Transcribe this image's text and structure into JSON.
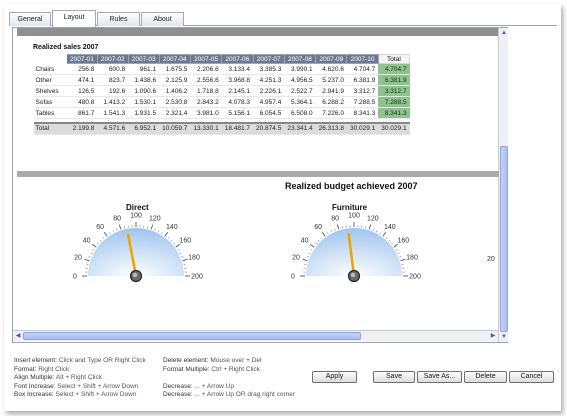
{
  "tabs": [
    {
      "label": "General"
    },
    {
      "label": "Layout"
    },
    {
      "label": "Rules"
    },
    {
      "label": "About"
    }
  ],
  "table": {
    "title": "Realized sales 2007",
    "columns": [
      "2007-01",
      "2007-02",
      "2007-03",
      "2007-04",
      "2007-05",
      "2007-06",
      "2007-07",
      "2007-08",
      "2007-09",
      "2007-10"
    ],
    "total_label": "Total",
    "rows": [
      {
        "label": "Chairs",
        "values": [
          "256.8",
          "600.8",
          "961.1",
          "1.675.5",
          "2.206.6",
          "3.133.4",
          "3.385.3",
          "3.990.1",
          "4.620.6",
          "4.704.7"
        ],
        "total": "4.704.7"
      },
      {
        "label": "Other",
        "values": [
          "474.1",
          "823.7",
          "1.438.6",
          "2.125.9",
          "2.556.6",
          "3.968.8",
          "4.251.3",
          "4.956.5",
          "5.237.0",
          "6.381.9"
        ],
        "total": "6.381.9"
      },
      {
        "label": "Shelves",
        "values": [
          "126.5",
          "192.6",
          "1.090.6",
          "1.406.2",
          "1.718.8",
          "2.145.1",
          "2.226.1",
          "2.522.7",
          "2.941.9",
          "3.312.7"
        ],
        "total": "3.312.7"
      },
      {
        "label": "Sofas",
        "values": [
          "480.8",
          "1.413.2",
          "1.530.1",
          "2.530.8",
          "2.843.2",
          "4.078.3",
          "4.957.4",
          "5.364.1",
          "6.288.2",
          "7.288.5"
        ],
        "total": "7.288.5"
      },
      {
        "label": "Tables",
        "values": [
          "861.7",
          "1.541.3",
          "1.931.5",
          "2.321.4",
          "3.981.0",
          "5.156.1",
          "6.054.5",
          "6.508.0",
          "7.226.0",
          "8.341.3"
        ],
        "total": "8.341.3"
      }
    ],
    "sum": {
      "label": "Total",
      "values": [
        "2.199.8",
        "4.571.6",
        "6.952.1",
        "10.059.7",
        "13.330.1",
        "18.481.7",
        "20.874.5",
        "23.341.4",
        "26.313.8",
        "30.029.1"
      ],
      "total": "30.029.1"
    }
  },
  "budget_title": "Realized budget achieved 2007",
  "gauges": [
    {
      "title": "Direct",
      "value": 88,
      "ticks": [
        "0",
        "20",
        "40",
        "60",
        "80",
        "100",
        "120",
        "140",
        "160",
        "180",
        "200"
      ]
    },
    {
      "title": "Furniture",
      "value": 92,
      "ticks": [
        "0",
        "20",
        "40",
        "60",
        "80",
        "100",
        "120",
        "140",
        "160",
        "180",
        "200"
      ]
    }
  ],
  "third_gauge_partial_tick": "20",
  "help": {
    "col1": [
      {
        "k": "Insert element: ",
        "v": "Click and Type OR Right Click"
      },
      {
        "k": "Format: ",
        "v": "Right Click"
      },
      {
        "k": "Align Multiple: ",
        "v": "Alt + Right Click"
      },
      {
        "k": "Font Increase: ",
        "v": "Select + Shift + Arrow Down"
      },
      {
        "k": "Box Increase: ",
        "v": "Select + Shift + Arrow Down"
      }
    ],
    "col2": [
      {
        "k": "Delete element: ",
        "v": "Mouse over + Del"
      },
      {
        "k": "Format Multiple: ",
        "v": "Ctrl + Right Click"
      },
      {
        "k": "",
        "v": ""
      },
      {
        "k": "Decrease: ",
        "v": "... + Arrow Up"
      },
      {
        "k": "Decrease: ",
        "v": "... + Arrow Up OR drag right corner"
      }
    ]
  },
  "buttons": {
    "apply": "Apply",
    "save": "Save",
    "save_as": "Save As...",
    "delete": "Delete",
    "cancel": "Cancel"
  },
  "colors": {
    "header_bg": "#6c7a91",
    "total_bg": "#8fc28c",
    "needle": "#e8a800",
    "scroll_thumb": "#a8bcf2"
  }
}
